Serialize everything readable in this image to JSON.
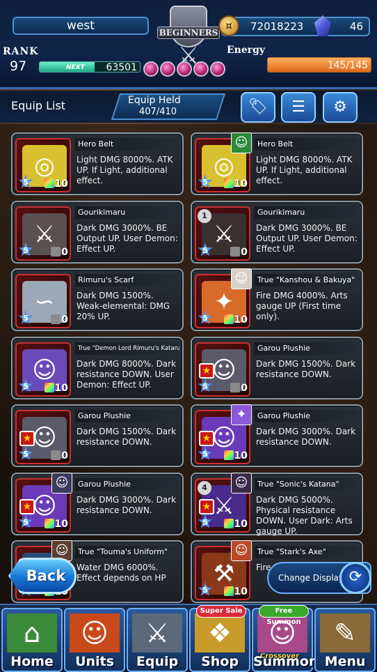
{
  "player": {
    "name": "west",
    "rank_label": "RANK",
    "rank": "97",
    "next_label": "NEXT",
    "next_exp": "63501",
    "next_progress": 0.55,
    "emblem_text": "BEGINNERS"
  },
  "currency": {
    "coins": "72018223",
    "gems": "46"
  },
  "energy": {
    "label": "Energy",
    "value": "145/145",
    "fill": 1.0
  },
  "subheader": {
    "title": "Equip List",
    "held_label": "Equip Held",
    "held_value": "407/410",
    "buttons": [
      {
        "icon": "tag-icon",
        "glyph": "🏷"
      },
      {
        "icon": "sliders-icon",
        "glyph": "☰"
      },
      {
        "icon": "gear-icon",
        "glyph": "⚙"
      }
    ]
  },
  "equips": [
    {
      "name": "Hero Belt",
      "desc": "Light DMG 8000%. ATK UP. If Light, additional effect.",
      "stars": "5",
      "level": "10",
      "art": "◎",
      "art_bg": "#d8c030",
      "border": "#cc3030",
      "portrait": false
    },
    {
      "name": "Hero Belt",
      "desc": "Light DMG 8000%. ATK UP. If Light, additional effect.",
      "stars": "5",
      "level": "10",
      "art": "◎",
      "art_bg": "#d8c030",
      "border": "#cc3030",
      "portrait": true,
      "portrait_color": "#2a8a3a",
      "portrait_glyph": "☺"
    },
    {
      "name": "Gourikimaru",
      "desc": "Dark DMG 3000%. BE Output UP. User Demon: Effect UP.",
      "stars": "5",
      "level": "0",
      "art": "⚔",
      "art_bg": "#5a5050",
      "border": "#cc3030",
      "portrait": false
    },
    {
      "name": "Gourikimaru",
      "desc": "Dark DMG 3000%. BE Output UP. User Demon: Effect UP.",
      "stars": "5",
      "level": "0",
      "art": "⚔",
      "art_bg": "#3a3030",
      "border": "#cc3030",
      "portrait": false,
      "rank_badge": "1"
    },
    {
      "name": "Rimuru's Scarf",
      "desc": "Dark DMG 1500%. Weak-elemental: DMG 20% UP.",
      "stars": "5",
      "level": "0",
      "art": "∽",
      "art_bg": "#9aa8b8",
      "border": "#cc3030",
      "portrait": false
    },
    {
      "name": "True \"Kanshou & Bakuya\"",
      "desc": "Fire DMG 4000%. Arts gauge UP (First time only).",
      "stars": "5",
      "level": "10",
      "art": "✦",
      "art_bg": "#d86a2a",
      "border": "#cc3030",
      "portrait": true,
      "portrait_color": "#d8d0c8",
      "portrait_glyph": "☺"
    },
    {
      "name": "True \"Demon Lord Rimuru's Katana\"",
      "desc": "Dark DMG 8000%. Dark resistance DOWN. User Demon: Effect UP.",
      "stars": "5",
      "level": "10",
      "art": "☺",
      "art_bg": "#6a4ab8",
      "border": "#cc3030",
      "portrait": false,
      "small_title": true
    },
    {
      "name": "Garou Plushie",
      "desc": "Dark DMG 1500%. Dark resistance DOWN.",
      "stars": "5",
      "level": "0",
      "art": "☺",
      "art_bg": "#5a5a6a",
      "border": "#cc3030",
      "portrait": false,
      "red_badge": true
    },
    {
      "name": "Garou Plushie",
      "desc": "Dark DMG 1500%. Dark resistance DOWN.",
      "stars": "5",
      "level": "0",
      "art": "☺",
      "art_bg": "#5a5a6a",
      "border": "#cc3030",
      "portrait": false,
      "red_badge": true
    },
    {
      "name": "Garou Plushie",
      "desc": "Dark DMG 3000%. Dark resistance DOWN.",
      "stars": "5",
      "level": "10",
      "art": "☺",
      "art_bg": "#6a3ab8",
      "border": "#cc3030",
      "portrait": true,
      "portrait_color": "#8a5ad8",
      "portrait_glyph": "✦",
      "red_badge": true
    },
    {
      "name": "Garou Plushie",
      "desc": "Dark DMG 3000%. Dark resistance DOWN.",
      "stars": "5",
      "level": "10",
      "art": "☺",
      "art_bg": "#6a3ab8",
      "border": "#cc3030",
      "portrait": true,
      "portrait_color": "#3a3a5a",
      "portrait_glyph": "☺",
      "red_badge": true
    },
    {
      "name": "True \"Sonic's Katana\"",
      "desc": "Dark DMG 5000%. Physical resistance DOWN. User Dark: Arts gauge UP.",
      "stars": "5",
      "level": "10",
      "art": "⚔",
      "art_bg": "#4a2a8a",
      "border": "#cc3030",
      "portrait": true,
      "portrait_color": "#3a2a4a",
      "portrait_glyph": "☺",
      "rank_badge": "4",
      "red_badge": true
    },
    {
      "name": "True \"Touma's Uniform\"",
      "desc": "Water DMG 6000%. Effect depends on HP",
      "stars": "5",
      "level": "10",
      "art": "▣",
      "art_bg": "#2a4a7a",
      "border": "#cc3030",
      "portrait": true,
      "portrait_color": "#5a4030",
      "portrait_glyph": "☺"
    },
    {
      "name": "True \"Stark's Axe\"",
      "desc": "Fire Ph",
      "stars": "5",
      "level": "10",
      "art": "⚒",
      "art_bg": "#8a3a1a",
      "border": "#cc3030",
      "portrait": true,
      "portrait_color": "#b84a2a",
      "portrait_glyph": "☺"
    }
  ],
  "controls": {
    "back_label": "Back",
    "change_display_label": "Change Display"
  },
  "nav": [
    {
      "label": "Home",
      "icon": "house-icon",
      "glyph": "⌂",
      "art_bg": "#3a8a3a"
    },
    {
      "label": "Units",
      "icon": "hero-icon",
      "glyph": "☺",
      "art_bg": "#c84a1a"
    },
    {
      "label": "Equip",
      "icon": "sword-icon",
      "glyph": "⚔",
      "art_bg": "#5a6a7a"
    },
    {
      "label": "Shop",
      "icon": "treasure-icon",
      "glyph": "❖",
      "art_bg": "#c89a2a",
      "tag": "Super Sale",
      "tag_color": "#d82a3a"
    },
    {
      "label": "Summon",
      "icon": "character-icon",
      "glyph": "☺",
      "art_bg": "#a84a8a",
      "tag": "Free Summon",
      "tag_color": "#3aa82a",
      "sub": "Crossover"
    },
    {
      "label": "Menu",
      "icon": "book-icon",
      "glyph": "✎",
      "art_bg": "#8a6a3a"
    }
  ]
}
